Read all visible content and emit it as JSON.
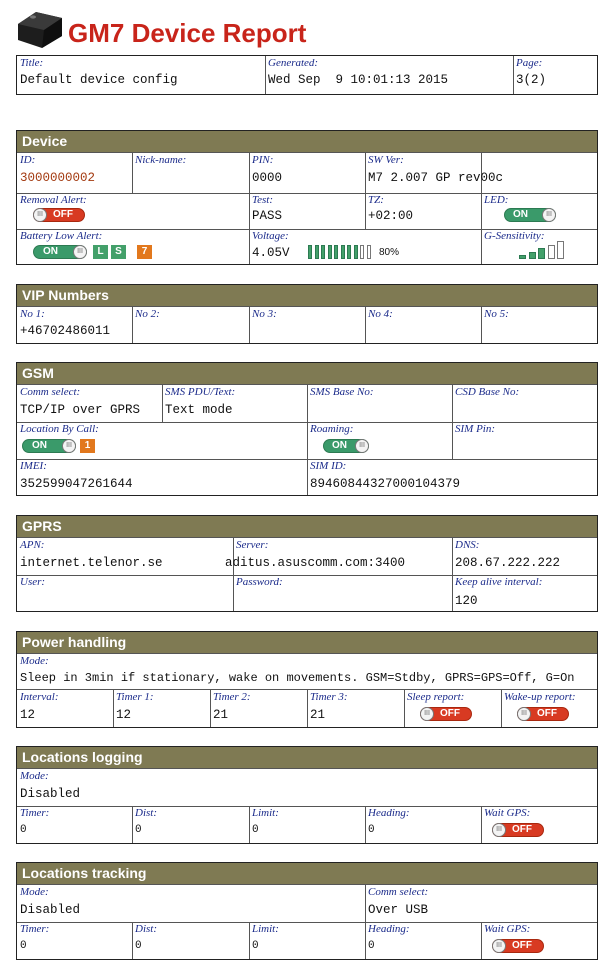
{
  "header": {
    "title": "GM7 Device Report",
    "title_label": "Title:",
    "title_value": "Default device config",
    "generated_label": "Generated:",
    "generated_value": "Wed Sep  9 10:01:13 2015",
    "page_label": "Page:",
    "page_value": "3(2)"
  },
  "device": {
    "heading": "Device",
    "id_label": "ID:",
    "id_value": "3000000002",
    "nick_label": "Nick-name:",
    "pin_label": "PIN:",
    "pin_value": "0000",
    "sw_label": "SW Ver:",
    "sw_value": "M7 2.007 GP rev00c",
    "removal_label": "Removal Alert:",
    "removal_state": "OFF",
    "test_label": "Test:",
    "test_value": "PASS",
    "tz_label": "TZ:",
    "tz_value": "+02:00",
    "led_label": "LED:",
    "led_state": "ON",
    "battery_label": "Battery Low Alert:",
    "battery_state": "ON",
    "battery_l": "L",
    "battery_s": "S",
    "battery_num": "7",
    "voltage_label": "Voltage:",
    "voltage_value": "4.05V",
    "battery_percent": "80%",
    "battery_level": 0.8,
    "gsens_label": "G-Sensitivity:",
    "gsens_level": 3
  },
  "vip": {
    "heading": "VIP Numbers",
    "no1_label": "No 1:",
    "no1_value": "+46702486011",
    "no2_label": "No 2:",
    "no3_label": "No 3:",
    "no4_label": "No 4:",
    "no5_label": "No 5:"
  },
  "gsm": {
    "heading": "GSM",
    "comm_label": "Comm select:",
    "comm_value": "TCP/IP over GPRS",
    "sms_label": "SMS PDU/Text:",
    "sms_value": "Text mode",
    "smsbase_label": "SMS Base No:",
    "csd_label": "CSD Base No:",
    "locbycall_label": "Location By Call:",
    "locbycall_state": "ON",
    "locbycall_num": "1",
    "roaming_label": "Roaming:",
    "roaming_state": "ON",
    "simpin_label": "SIM Pin:",
    "imei_label": "IMEI:",
    "imei_value": "352599047261644",
    "simid_label": "SIM ID:",
    "simid_value": "89460844327000104379"
  },
  "gprs": {
    "heading": "GPRS",
    "apn_label": "APN:",
    "apn_value": "internet.telenor.se",
    "server_label": "Server:",
    "server_value": "aditus.asuscomm.com:3400",
    "dns_label": "DNS:",
    "dns_value": "208.67.222.222",
    "user_label": "User:",
    "password_label": "Password:",
    "keepalive_label": "Keep alive interval:",
    "keepalive_value": "120"
  },
  "power": {
    "heading": "Power handling",
    "mode_label": "Mode:",
    "mode_value": "Sleep in 3min if stationary, wake on movements. GSM=Stdby, GPRS=GPS=Off, G=On",
    "interval_label": "Interval:",
    "interval_value": "12",
    "timer1_label": "Timer 1:",
    "timer1_value": "12",
    "timer2_label": "Timer 2:",
    "timer2_value": "21",
    "timer3_label": "Timer 3:",
    "timer3_value": "21",
    "sleep_label": "Sleep report:",
    "sleep_state": "OFF",
    "wake_label": "Wake-up report:",
    "wake_state": "OFF"
  },
  "logging": {
    "heading": "Locations logging",
    "mode_label": "Mode:",
    "mode_value": "Disabled",
    "timer_label": "Timer:",
    "timer_value": "0",
    "dist_label": "Dist:",
    "dist_value": "0",
    "limit_label": "Limit:",
    "limit_value": "0",
    "heading_label": "Heading:",
    "heading_value": "0",
    "waitgps_label": "Wait GPS:",
    "waitgps_state": "OFF"
  },
  "tracking": {
    "heading": "Locations tracking",
    "mode_label": "Mode:",
    "mode_value": "Disabled",
    "comm_label": "Comm select:",
    "comm_value": "Over USB",
    "timer_label": "Timer:",
    "timer_value": "0",
    "dist_label": "Dist:",
    "dist_value": "0",
    "limit_label": "Limit:",
    "limit_value": "0",
    "heading_label": "Heading:",
    "heading_value": "0",
    "waitgps_label": "Wait GPS:",
    "waitgps_state": "OFF"
  },
  "colors": {
    "section_header": "#7f7a53",
    "label": "#1a2a8a",
    "on": "#3a9a6a",
    "off": "#d83a22",
    "accent_title": "#c8241a"
  }
}
